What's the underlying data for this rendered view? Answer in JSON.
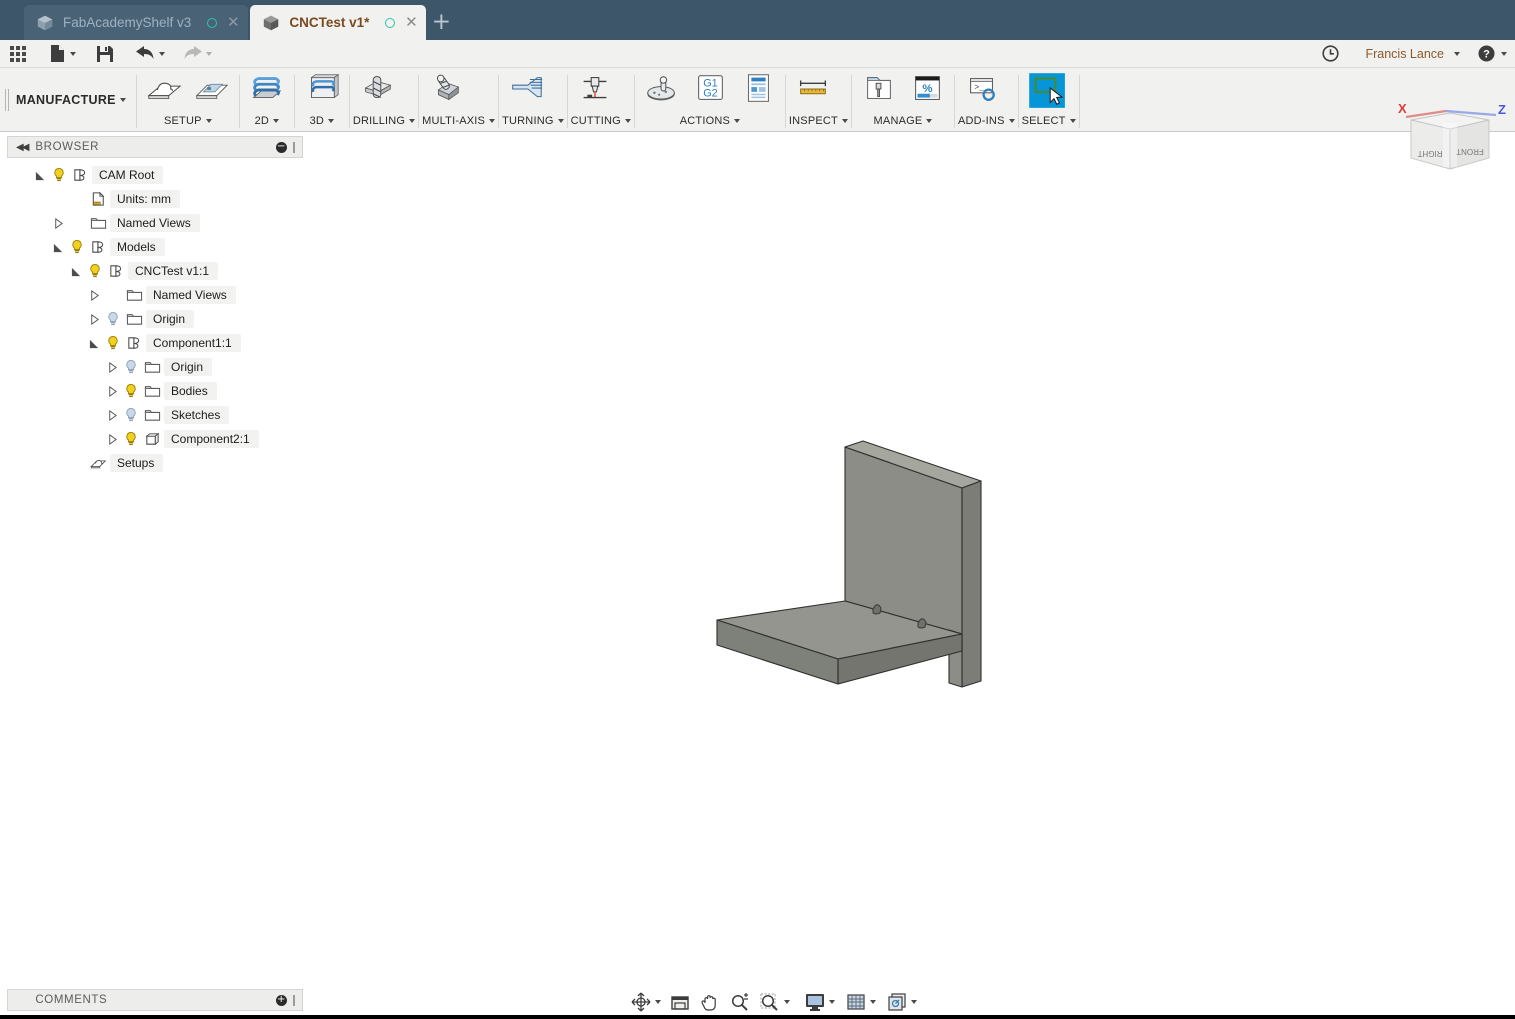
{
  "app": {
    "workspace": "MANUFACTURE",
    "title_bar_color": "#3e566a",
    "accent_select_blue": "#0696d7",
    "model_gray": "#8a8c86"
  },
  "tabs": [
    {
      "label": "FabAcademyShelf v3",
      "active": false,
      "icon": "cube-icon",
      "close": "✕",
      "status_dot": "sync-circle-icon"
    },
    {
      "label": "CNCTest v1*",
      "active": true,
      "icon": "cube-icon",
      "close": "✕",
      "status_dot": "sync-circle-icon"
    }
  ],
  "new_tab_label": "+",
  "quick_access": {
    "items": [
      {
        "name": "app-grid-button",
        "icon": "grid-9-icon",
        "caret": false
      },
      {
        "name": "new-file-button",
        "icon": "file-new-icon",
        "caret": true
      },
      {
        "name": "save-button",
        "icon": "floppy-save-icon",
        "caret": false
      },
      {
        "name": "undo-button",
        "icon": "undo-arrow-icon",
        "caret": true
      },
      {
        "name": "redo-button",
        "icon": "redo-arrow-icon",
        "caret": true,
        "disabled": true
      }
    ],
    "recent_label": "recent-activity-icon",
    "user_name": "Francis Lance",
    "help_label": "?"
  },
  "ribbon": {
    "workspace_label": "MANUFACTURE",
    "groups": [
      {
        "name": "setup",
        "label": "SETUP",
        "caret": true,
        "buttons": [
          {
            "name": "new-setup-button",
            "icon": "setup-stock-icon"
          },
          {
            "name": "new-folder-button",
            "icon": "setup-folder-icon"
          }
        ]
      },
      {
        "name": "2d",
        "label": "2D",
        "caret": true,
        "buttons": [
          {
            "name": "toolpath-2d-button",
            "icon": "toolpath-2d-icon"
          }
        ]
      },
      {
        "name": "3d",
        "label": "3D",
        "caret": true,
        "buttons": [
          {
            "name": "toolpath-3d-button",
            "icon": "toolpath-3d-icon"
          }
        ]
      },
      {
        "name": "drilling",
        "label": "DRILLING",
        "caret": true,
        "buttons": [
          {
            "name": "drilling-button",
            "icon": "drill-icon"
          }
        ]
      },
      {
        "name": "multi-axis",
        "label": "MULTI-AXIS",
        "caret": true,
        "buttons": [
          {
            "name": "multi-axis-button",
            "icon": "multi-axis-icon"
          }
        ]
      },
      {
        "name": "turning",
        "label": "TURNING",
        "caret": true,
        "buttons": [
          {
            "name": "turning-button",
            "icon": "turning-icon"
          }
        ]
      },
      {
        "name": "cutting",
        "label": "CUTTING",
        "caret": true,
        "buttons": [
          {
            "name": "cutting-button",
            "icon": "cutting-jet-icon"
          }
        ]
      },
      {
        "name": "actions",
        "label": "ACTIONS",
        "caret": true,
        "buttons": [
          {
            "name": "simulate-button",
            "icon": "simulate-icon"
          },
          {
            "name": "post-process-button",
            "icon": "g1g2-icon"
          },
          {
            "name": "setup-sheet-button",
            "icon": "setup-sheet-icon"
          }
        ]
      },
      {
        "name": "inspect",
        "label": "INSPECT",
        "caret": true,
        "buttons": [
          {
            "name": "measure-button",
            "icon": "ruler-measure-icon"
          }
        ]
      },
      {
        "name": "manage",
        "label": "MANAGE",
        "caret": true,
        "buttons": [
          {
            "name": "tool-library-button",
            "icon": "tool-library-icon"
          },
          {
            "name": "machining-time-button",
            "icon": "percent-progress-icon"
          }
        ]
      },
      {
        "name": "add-ins",
        "label": "ADD-INS",
        "caret": true,
        "buttons": [
          {
            "name": "scripts-addins-button",
            "icon": "console-gear-icon"
          }
        ]
      },
      {
        "name": "select",
        "label": "SELECT",
        "caret": true,
        "buttons": [
          {
            "name": "select-mode-button",
            "icon": "select-cursor-icon"
          }
        ]
      }
    ],
    "g_code_text": {
      "line1": "G1",
      "line2": "G2"
    },
    "percent_text": "%",
    "console_text": ">_"
  },
  "browser": {
    "title": "BROWSER",
    "collapse_icon": "collapse-left-icon",
    "minimize_icon": "minimize-icon",
    "tree": [
      {
        "label": "CAM Root",
        "indent": 0,
        "toggle": "open",
        "bulb": "on",
        "icon": "assembly-icon"
      },
      {
        "label": "Units: mm",
        "indent": 1,
        "toggle": "none",
        "bulb": "none",
        "icon": "units-doc-icon"
      },
      {
        "label": "Named Views",
        "indent": 1,
        "toggle": "closed",
        "bulb": "none",
        "icon": "folder-icon"
      },
      {
        "label": "Models",
        "indent": 1,
        "toggle": "open",
        "bulb": "on",
        "icon": "assembly-icon"
      },
      {
        "label": "CNCTest v1:1",
        "indent": 2,
        "toggle": "open",
        "bulb": "on",
        "icon": "assembly-icon"
      },
      {
        "label": "Named Views",
        "indent": 3,
        "toggle": "closed",
        "bulb": "none",
        "icon": "folder-icon"
      },
      {
        "label": "Origin",
        "indent": 3,
        "toggle": "closed",
        "bulb": "off",
        "icon": "folder-icon"
      },
      {
        "label": "Component1:1",
        "indent": 3,
        "toggle": "open",
        "bulb": "on",
        "icon": "assembly-icon"
      },
      {
        "label": "Origin",
        "indent": 4,
        "toggle": "closed",
        "bulb": "off",
        "icon": "folder-icon"
      },
      {
        "label": "Bodies",
        "indent": 4,
        "toggle": "closed",
        "bulb": "on",
        "icon": "folder-icon"
      },
      {
        "label": "Sketches",
        "indent": 4,
        "toggle": "closed",
        "bulb": "off",
        "icon": "folder-icon"
      },
      {
        "label": "Component2:1",
        "indent": 4,
        "toggle": "closed",
        "bulb": "on",
        "icon": "body-cube-icon"
      },
      {
        "label": "Setups",
        "indent": 1,
        "toggle": "none",
        "bulb": "none",
        "icon": "setups-icon"
      }
    ]
  },
  "comments": {
    "title": "COMMENTS",
    "add_icon": "add-comment-icon"
  },
  "viewcube": {
    "axis_x": "X",
    "axis_z": "Z",
    "face_front": "FRONT",
    "face_right": "RIGHT"
  },
  "navbar": {
    "items": [
      {
        "name": "orbit-button",
        "icon": "orbit-icon",
        "caret": true
      },
      {
        "name": "zoom-window-button",
        "icon": "view-window-icon",
        "caret": false
      },
      {
        "name": "pan-button",
        "icon": "hand-pan-icon",
        "caret": false
      },
      {
        "name": "zoom-button",
        "icon": "zoom-plusminus-icon",
        "caret": false
      },
      {
        "name": "fit-button",
        "icon": "zoom-fit-icon",
        "caret": true
      },
      {
        "name": "display-settings-button",
        "icon": "monitor-display-icon",
        "caret": true
      },
      {
        "name": "grid-snaps-button",
        "icon": "grid-snap-icon",
        "caret": true
      },
      {
        "name": "viewports-button",
        "icon": "viewports-icon",
        "caret": true
      }
    ]
  },
  "model": {
    "description": "shelf-bracket-3d-model",
    "face_light": "#9a9c95",
    "face_mid": "#8a8c85",
    "face_dark": "#7b7d76",
    "edge": "#2f2f2f"
  }
}
